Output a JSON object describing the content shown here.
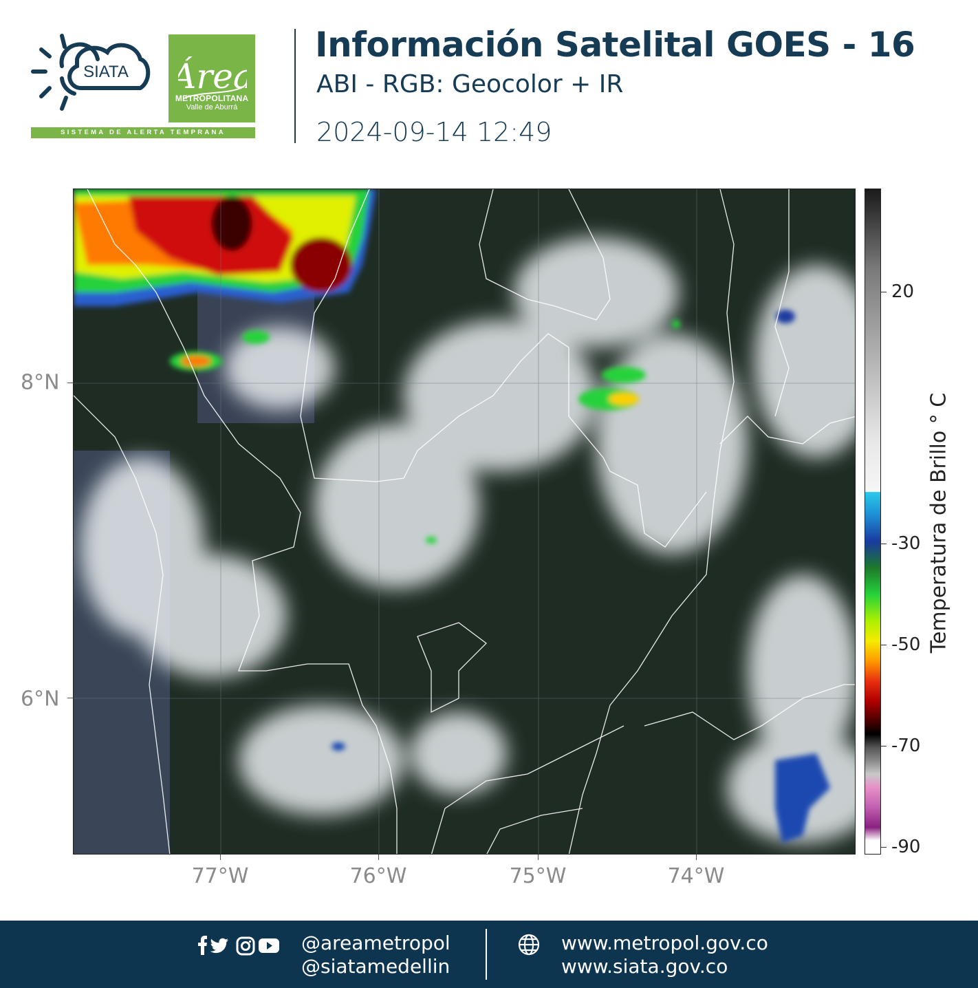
{
  "header": {
    "title": "Información Satelital GOES - 16",
    "subtitle": "ABI - RGB: Geocolor + IR",
    "datetime": "2024-09-14 12:49"
  },
  "logos": {
    "siata_text": "SIATA",
    "siata_strip": "SISTEMA DE ALERTA TEMPRANA",
    "area_script": "Área",
    "area_line1": "METROPOLITANA",
    "area_line2": "Valle de Aburrá"
  },
  "map": {
    "x_ticks": [
      "77°W",
      "76°W",
      "75°W",
      "74°W"
    ],
    "y_ticks": [
      "8°N",
      "6°N"
    ],
    "colorbar": {
      "title": "Temperatura de Brillo ° C",
      "labels": [
        "20",
        "-30",
        "-50",
        "-70",
        "-90"
      ]
    }
  },
  "footer": {
    "handles": [
      "@areametropol",
      "@siatamedellin"
    ],
    "urls": [
      "www.metropol.gov.co",
      "www.siata.gov.co"
    ]
  },
  "colors": {
    "brand_green": "#7ab547",
    "brand_navy": "#0e3550"
  }
}
